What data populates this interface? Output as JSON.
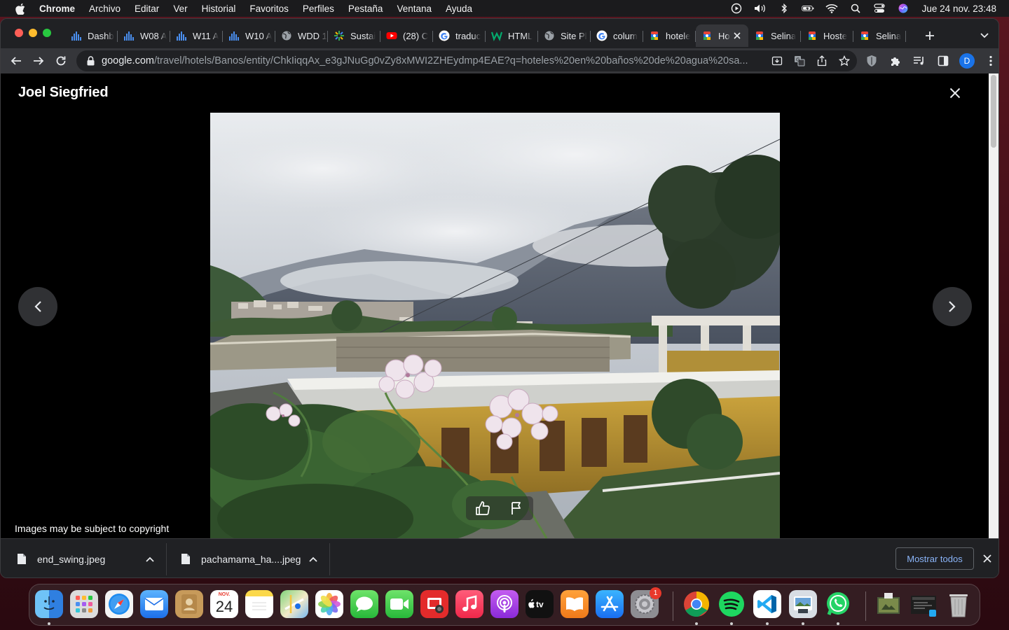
{
  "menubar": {
    "app": "Chrome",
    "menus": [
      "Archivo",
      "Editar",
      "Ver",
      "Historial",
      "Favoritos",
      "Perfiles",
      "Pestaña",
      "Ventana",
      "Ayuda"
    ],
    "clock": "Jue 24 nov.  23:48"
  },
  "tabs": [
    {
      "label": "Dashb",
      "icon": "bar-chart-icon"
    },
    {
      "label": "W08 A",
      "icon": "bar-chart-icon"
    },
    {
      "label": "W11 A",
      "icon": "bar-chart-icon"
    },
    {
      "label": "W10 A",
      "icon": "bar-chart-icon"
    },
    {
      "label": "WDD 1",
      "icon": "globe-icon"
    },
    {
      "label": "Sustai",
      "icon": "sparkle-icon"
    },
    {
      "label": "(28) C",
      "icon": "youtube-icon"
    },
    {
      "label": "traduc",
      "icon": "google-icon"
    },
    {
      "label": "HTML",
      "icon": "w-icon"
    },
    {
      "label": "Site Pl",
      "icon": "globe-icon"
    },
    {
      "label": "colum",
      "icon": "google-icon"
    },
    {
      "label": "hotele",
      "icon": "travel-icon"
    },
    {
      "label": "Ho",
      "icon": "travel-icon",
      "active": true
    },
    {
      "label": "Selina",
      "icon": "travel-icon"
    },
    {
      "label": "Hoste",
      "icon": "travel-icon"
    },
    {
      "label": "Selina",
      "icon": "travel-icon"
    }
  ],
  "address_bar": {
    "host": "google.com",
    "path": "/travel/hotels/Banos/entity/ChkIiqqAx_e3gJNuGg0vZy8xMWI2ZHEydmp4EAE?q=hoteles%20en%20baños%20de%20agua%20sa..."
  },
  "profile_initial": "D",
  "lightbox": {
    "photographer": "Joel Siegfried",
    "copyright_notice": "Images may be subject to copyright"
  },
  "downloads": {
    "items": [
      {
        "filename": "end_swing.jpeg"
      },
      {
        "filename": "pachamama_ha....jpeg"
      }
    ],
    "show_all_label": "Mostrar todos"
  },
  "dock": {
    "calendar_month": "NOV.",
    "calendar_day": "24",
    "settings_badge": "1"
  },
  "colors": {
    "accent": "#8ab4f8",
    "profile": "#1a73e8",
    "badge": "#e8382b"
  }
}
